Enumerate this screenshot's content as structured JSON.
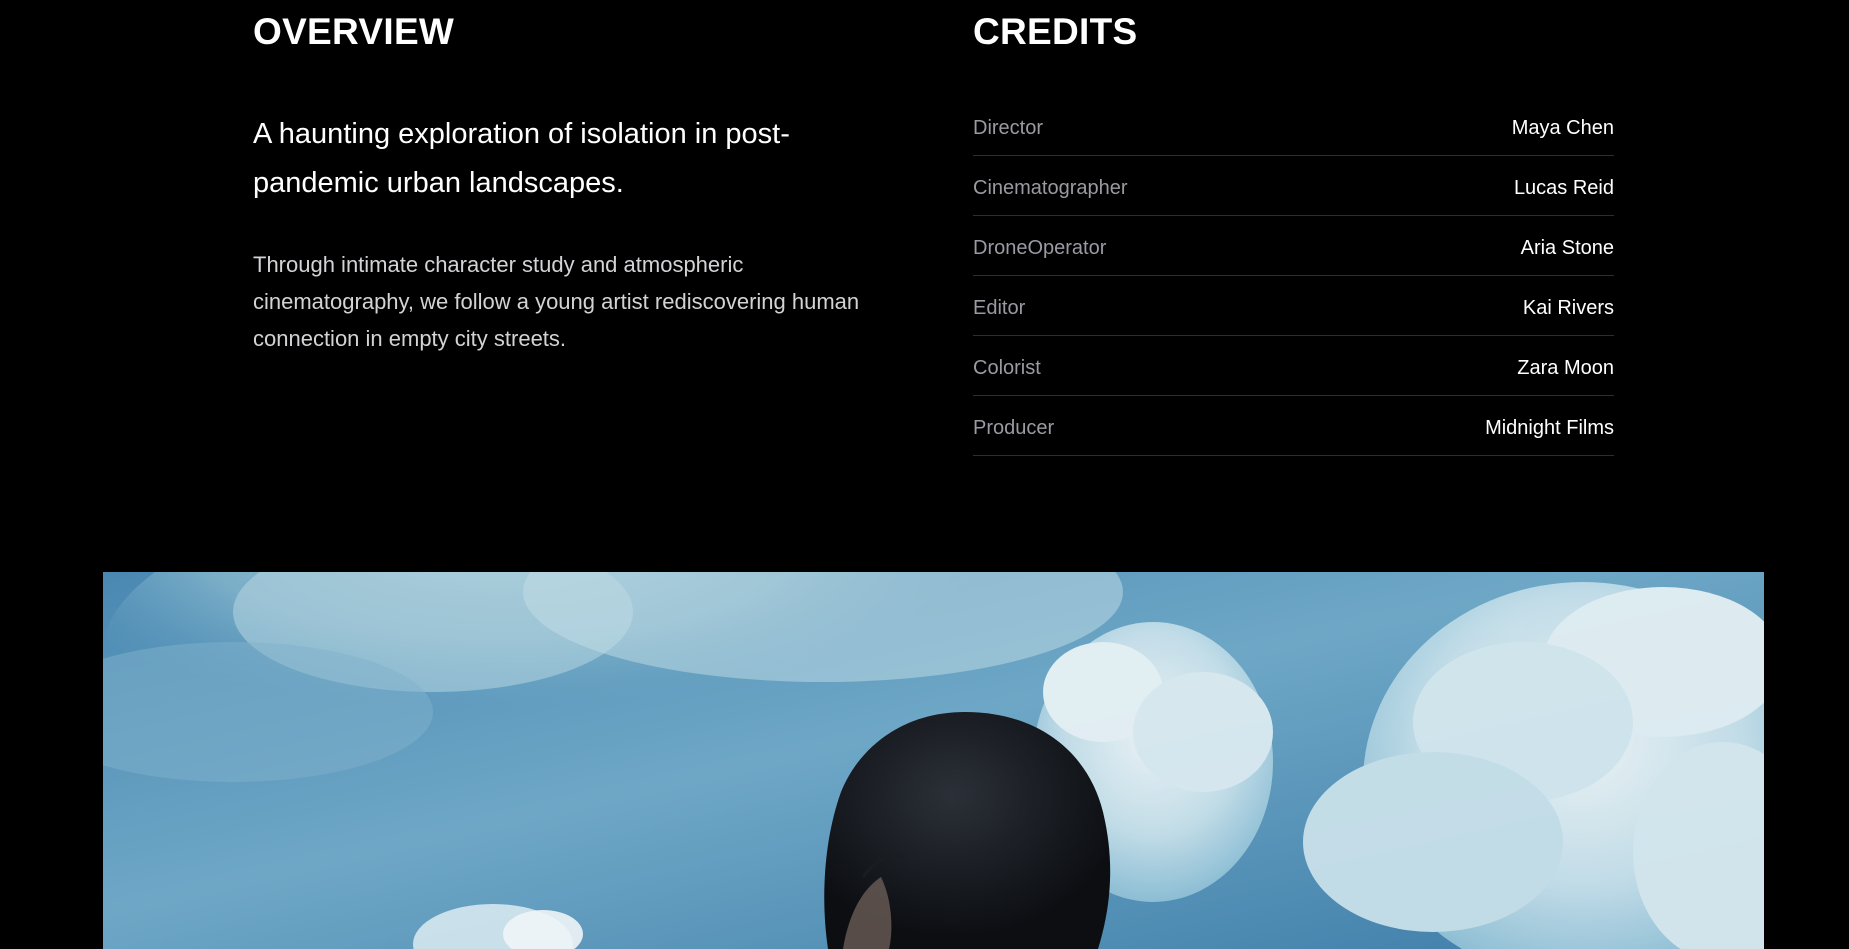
{
  "overview": {
    "title": "OVERVIEW",
    "tagline": "A haunting exploration of isolation in post-pandemic urban landscapes.",
    "synopsis": "Through intimate character study and atmospheric cinematography, we follow a young artist rediscovering human connection in empty city streets."
  },
  "credits": {
    "title": "CREDITS",
    "items": [
      {
        "role": "Director",
        "name": "Maya Chen"
      },
      {
        "role": "Cinematographer",
        "name": "Lucas Reid"
      },
      {
        "role": "DroneOperator",
        "name": "Aria Stone"
      },
      {
        "role": "Editor",
        "name": "Kai Rivers"
      },
      {
        "role": "Colorist",
        "name": "Zara Moon"
      },
      {
        "role": "Producer",
        "name": "Midnight Films"
      }
    ]
  },
  "colors": {
    "background": "#000000",
    "role_text": "#9a9aa3",
    "divider": "#2a2c3c",
    "sky": "#4b8bb3"
  }
}
